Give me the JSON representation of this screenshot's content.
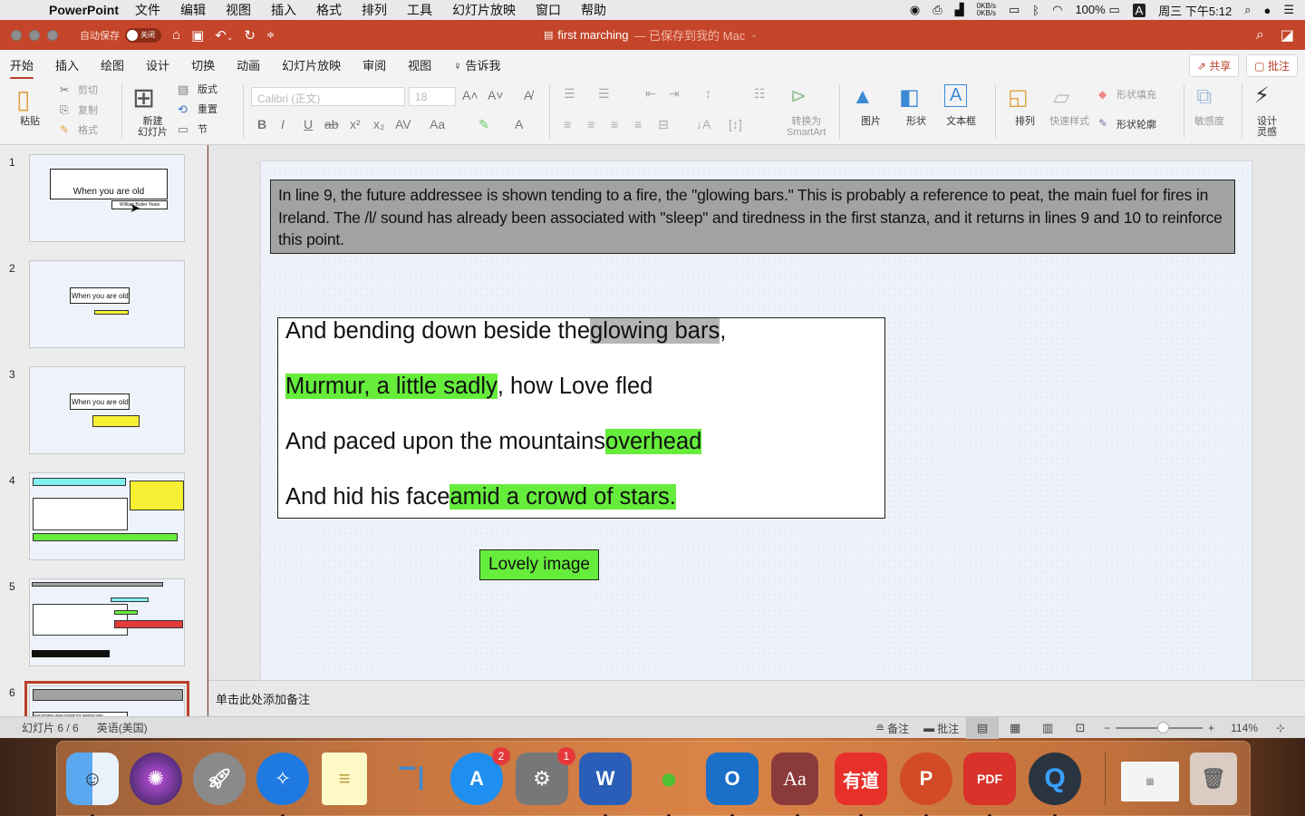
{
  "menubar": {
    "app_name": "PowerPoint",
    "items": [
      "文件",
      "编辑",
      "视图",
      "插入",
      "格式",
      "排列",
      "工具",
      "幻灯片放映",
      "窗口",
      "帮助"
    ],
    "net_up": "0KB/s",
    "net_down": "0KB/s",
    "battery": "100%",
    "input_method": "A",
    "clock": "周三 下午5:12"
  },
  "titlebar": {
    "autosave_label": "自动保存",
    "autosave_state": "关闭",
    "doc_name": "first marching",
    "doc_status": "— 已保存到我的 Mac"
  },
  "ribbon_tabs": {
    "items": [
      "开始",
      "插入",
      "绘图",
      "设计",
      "切换",
      "动画",
      "幻灯片放映",
      "审阅",
      "视图"
    ],
    "active": "开始",
    "tell_me": "告诉我",
    "share": "共享",
    "comments": "批注"
  },
  "ribbon": {
    "paste": "粘贴",
    "cut": "剪切",
    "copy": "复制",
    "format_painter": "格式",
    "new_slide": "新建\n幻灯片",
    "new_slide_l1": "新建",
    "new_slide_l2": "幻灯片",
    "layout": "版式",
    "reset": "重置",
    "section": "节",
    "font_name": "Calibri (正文)",
    "font_size": "18",
    "convert_smartart_l1": "转换为",
    "convert_smartart_l2": "SmartArt",
    "picture": "图片",
    "shape": "形状",
    "textbox": "文本框",
    "arrange": "排列",
    "quick_styles": "快速样式",
    "shape_fill": "形状填充",
    "shape_outline": "形状轮廓",
    "sensitivity": "敏感度",
    "designer_l1": "设计",
    "designer_l2": "灵感"
  },
  "thumbnails": [
    {
      "num": "1",
      "title": "When you are old",
      "subtitle": "William Butler Yeats"
    },
    {
      "num": "2",
      "title": "When you are old"
    },
    {
      "num": "3",
      "title": "When you are old"
    },
    {
      "num": "4"
    },
    {
      "num": "5"
    },
    {
      "num": "6",
      "line": "And bending down beside the glowing bars,"
    }
  ],
  "slide": {
    "note": "In line 9, the future addressee is shown tending to a fire, the \"glowing bars.\" This is probably a reference to peat, the main fuel for fires in Ireland. The /l/ sound has already been associated with \"sleep\" and tiredness in the first stanza, and it returns in lines 9 and 10 to reinforce this point.",
    "poem": [
      {
        "plain1": "And bending down beside the ",
        "hl": "glowing bars",
        "hl_color": "grey",
        "plain2": ","
      },
      {
        "plain1": "",
        "hl": "Murmur, a little sadly",
        "hl_color": "green",
        "plain2": ", how Love fled"
      },
      {
        "plain1": "And paced upon the mountains ",
        "hl": "overhead",
        "hl_color": "green",
        "plain2": ""
      },
      {
        "plain1": "And hid his face ",
        "hl": "amid a crowd of stars.",
        "hl_color": "green",
        "plain2": ""
      }
    ],
    "label": "Lovely image"
  },
  "notes_placeholder": "单击此处添加备注",
  "status": {
    "slide_counter": "幻灯片 6 / 6",
    "language": "英语(美国)",
    "notes_btn": "备注",
    "comments_btn": "批注",
    "zoom": "114%",
    "zoom_minus": "−",
    "zoom_plus": "+"
  },
  "dock": {
    "apps": [
      {
        "name": "Finder",
        "badge": ""
      },
      {
        "name": "Siri",
        "badge": ""
      },
      {
        "name": "Launchpad",
        "badge": ""
      },
      {
        "name": "Safari",
        "badge": ""
      },
      {
        "name": "Notes",
        "badge": ""
      },
      {
        "name": "Keynote",
        "badge": ""
      },
      {
        "name": "App Store",
        "badge": "2"
      },
      {
        "name": "System Preferences",
        "badge": "1"
      },
      {
        "name": "Word",
        "badge": "",
        "glyph": "W"
      },
      {
        "name": "WeChat",
        "badge": ""
      },
      {
        "name": "Outlook",
        "badge": "",
        "glyph": "O"
      },
      {
        "name": "Dictionary",
        "badge": "",
        "glyph": "Aa"
      },
      {
        "name": "Youdao",
        "badge": "",
        "glyph": "有道"
      },
      {
        "name": "PowerPoint",
        "badge": "",
        "glyph": "P"
      },
      {
        "name": "PDF Expert",
        "badge": "",
        "glyph": "PDF"
      },
      {
        "name": "QuickTime",
        "badge": "",
        "glyph": "Q"
      }
    ]
  },
  "colors": {
    "accent": "#c4452a",
    "highlight_green": "#66ed3c",
    "highlight_grey": "#b5b5b5",
    "note_box": "#a2a2a2"
  }
}
